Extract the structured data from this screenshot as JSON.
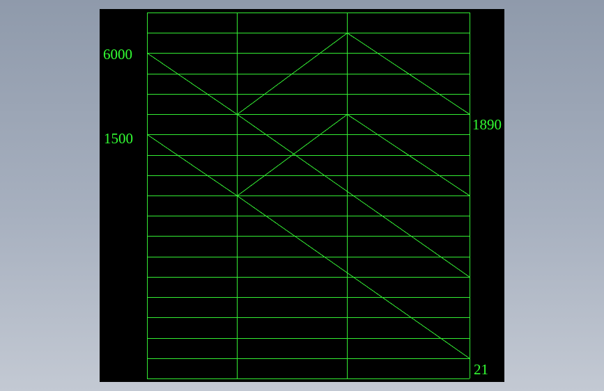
{
  "colors": {
    "canvas": "#000000",
    "lines": "#33ee33",
    "text": "#33ff33"
  },
  "grid": {
    "rows": 18,
    "columns": 3
  },
  "labels": {
    "input_high": "6000",
    "input_low": "1500",
    "output_high": "1890",
    "output_low": "21"
  }
}
